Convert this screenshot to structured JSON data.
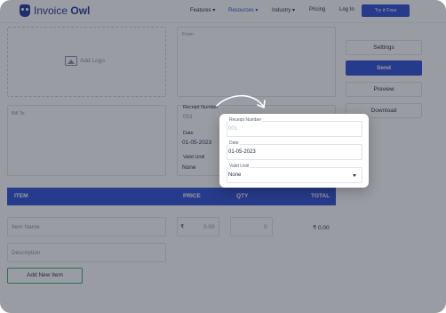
{
  "nav": {
    "logo_text_1": "Invoice",
    "logo_text_2": "Owl",
    "links": [
      {
        "label": "Features ▾",
        "active": false
      },
      {
        "label": "Resources ▾",
        "active": true
      },
      {
        "label": "Industry ▾",
        "active": false
      },
      {
        "label": "Pricing",
        "active": false
      },
      {
        "label": "Log In",
        "active": false
      }
    ],
    "cta": "Try it Free"
  },
  "editor": {
    "add_logo": "Add Logo",
    "from_label": "From",
    "bill_to_label": "Bill To",
    "receipt_number_label": "Receipt Number",
    "receipt_number_value": "001",
    "date_label": "Date",
    "date_value": "01-05-2023",
    "valid_until_label": "Valid Until",
    "valid_until_value": "None",
    "table": {
      "headers": [
        "ITEM",
        "PRICE",
        "QTY",
        "TOTAL"
      ],
      "item_placeholder": "Item Name",
      "currency": "₹",
      "price_value": "0.00",
      "qty_value": "0",
      "total_value": "₹ 0.00",
      "description_placeholder": "Description"
    },
    "add_item_label": "Add New Item"
  },
  "sidebar": {
    "settings": "Settings",
    "send": "Send",
    "preview": "Preview",
    "download": "Download"
  },
  "popup": {
    "receipt_number_label": "Receipt Number",
    "receipt_number_placeholder": "001",
    "date_label": "Date",
    "date_value": "01-05-2023",
    "valid_until_label": "Valid Until",
    "valid_until_value": "None"
  },
  "colors": {
    "brand": "#2d4fd4",
    "accent_green": "#34b26a",
    "overlay": "rgba(30,36,52,0.45)"
  }
}
